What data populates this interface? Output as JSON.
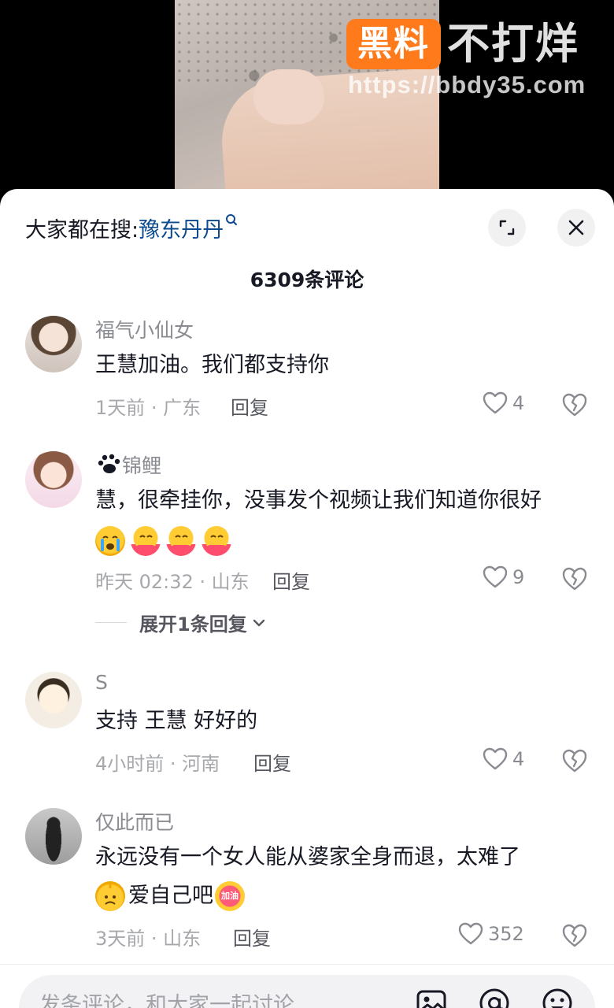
{
  "watermark": {
    "badge": "黑料",
    "text": "不打烊",
    "url": "https://bbdy35.com"
  },
  "sheet": {
    "search_prefix": "大家都在搜:",
    "search_keyword": "豫东丹丹",
    "comment_count": "6309条评论"
  },
  "comments": [
    {
      "username": "福气小仙女",
      "text": "王慧加油。我们都支持你",
      "meta": "1天前 · 广东",
      "reply": "回复",
      "likes": "4"
    },
    {
      "username": "锦鲤",
      "text": "慧，很牵挂你，没事发个视频让我们知道你很好",
      "meta": "昨天 02:32 · 山东",
      "reply": "回复",
      "likes": "9",
      "expand": "展开1条回复",
      "emojis": [
        "crying-emoji",
        "hug-emoji",
        "hug-emoji",
        "hug-emoji"
      ]
    },
    {
      "username": "S",
      "text": "支持 王慧 好好的",
      "meta": "4小时前 · 河南",
      "reply": "回复",
      "likes": "4"
    },
    {
      "username": "仅此而已",
      "text": "永远没有一个女人能从婆家全身而退，太难了",
      "text2": "爱自己吧",
      "meta": "3天前 · 山东",
      "reply": "回复",
      "likes": "352",
      "emojis": [
        "sad-emoji",
        "jiayou-sticker"
      ],
      "sticker_text": "加油"
    }
  ],
  "input": {
    "placeholder": "发条评论，和大家一起讨论"
  },
  "colors": {
    "accent_blue": "#0b4a8f",
    "watermark_orange": "#ff7a1a",
    "text_primary": "#161823",
    "text_secondary": "#8a8b91"
  }
}
